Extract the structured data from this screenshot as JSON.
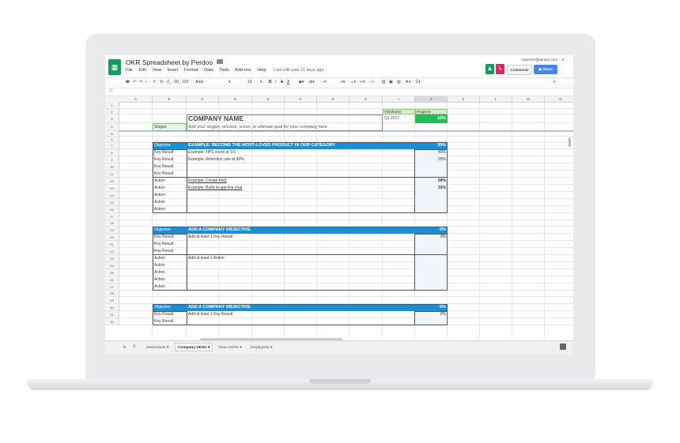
{
  "app": {
    "title": "OKR Spreadsheet by Perdoo",
    "last_edit": "Last edit was 12 days ago",
    "user": "maresch@perdoo.com"
  },
  "menu": [
    "File",
    "Edit",
    "View",
    "Insert",
    "Format",
    "Data",
    "Tools",
    "Add-ons",
    "Help"
  ],
  "buttons": {
    "comments": "Comments",
    "share": "Share"
  },
  "toolbar": {
    "font": "Arial",
    "size": "10",
    "zoom": "123",
    "currency": "€",
    "percent": "%",
    "dec0": ".0_",
    "dec00": ".00_",
    "bold": "B",
    "italic": "I",
    "strike": "S",
    "textcolor": "A"
  },
  "fx": "fx",
  "columns": [
    "A",
    "B",
    "C",
    "D",
    "E",
    "F",
    "G",
    "H",
    "I",
    "J",
    "K",
    "L",
    "M",
    "N"
  ],
  "rows": [
    "1",
    "2",
    "3",
    "4",
    "5",
    "6",
    "7",
    "8",
    "9",
    "10",
    "11",
    "12",
    "13",
    "14",
    "15",
    "16",
    "17",
    "18",
    "19",
    "20",
    "21",
    "22",
    "23",
    "24",
    "25",
    "26",
    "27",
    "28",
    "29",
    "30",
    "31",
    "32"
  ],
  "header": {
    "company_name": "COMPANY NAME",
    "slogan_label": "Slogan",
    "slogan_text": "Add your slogan, mission, vision, or ultimate goal for your company here",
    "timeframe_label": "Timeframe",
    "timeframe_value": "Q1 2017",
    "progress_label": "Progress",
    "progress_value": "10%"
  },
  "objective1": {
    "label": "Objective",
    "title": "EXAMPLE: BECOME THE MOST-LOVED PRODUCT IN OUR CATEGORY",
    "progress": "30%",
    "rows": [
      {
        "type": "Key Result",
        "text": "Example: NPS score at 9.5",
        "value": "40%"
      },
      {
        "type": "Key Result",
        "text": "Example: Retention rate at 90%",
        "value": "20%"
      },
      {
        "type": "Key Result",
        "text": "",
        "value": ""
      },
      {
        "type": "Key Result",
        "text": "",
        "value": ""
      },
      {
        "type": "Action",
        "text": "Example: Create FAQ",
        "value": "59%"
      },
      {
        "type": "Action",
        "text": "Example: Build in-app live chat",
        "value": "33%"
      },
      {
        "type": "Action",
        "text": "",
        "value": ""
      },
      {
        "type": "Action",
        "text": "",
        "value": ""
      },
      {
        "type": "Action",
        "text": "",
        "value": ""
      }
    ]
  },
  "objective2": {
    "label": "Objective",
    "title": "ADD A COMPANY OBJECTIVE",
    "progress": "0%",
    "rows": [
      {
        "type": "Key Result",
        "text": "Add at least 1 Key Result",
        "value": "0%"
      },
      {
        "type": "Key Result",
        "text": "",
        "value": ""
      },
      {
        "type": "Key Result",
        "text": "",
        "value": ""
      },
      {
        "type": "Action",
        "text": "Add at least 1 Action",
        "value": ""
      },
      {
        "type": "Action",
        "text": "",
        "value": ""
      },
      {
        "type": "Action",
        "text": "",
        "value": ""
      },
      {
        "type": "Action",
        "text": "",
        "value": ""
      },
      {
        "type": "Action",
        "text": "",
        "value": ""
      }
    ]
  },
  "objective3": {
    "label": "Objective",
    "title": "ADD A COMPANY OBJECTIVE",
    "progress": "0%",
    "rows": [
      {
        "type": "Key Result",
        "text": "Add at least 1 Key Result",
        "value": "0%"
      },
      {
        "type": "Key Result",
        "text": "",
        "value": ""
      }
    ]
  },
  "tabs": [
    "Instructions",
    "Company OKRs",
    "Team OKRs",
    "Employees"
  ],
  "active_tab": "Company OKRs",
  "colors": {
    "objective_blue": "#1a8fd6",
    "progress_green": "#1fbf55",
    "share_blue": "#4285f4"
  }
}
